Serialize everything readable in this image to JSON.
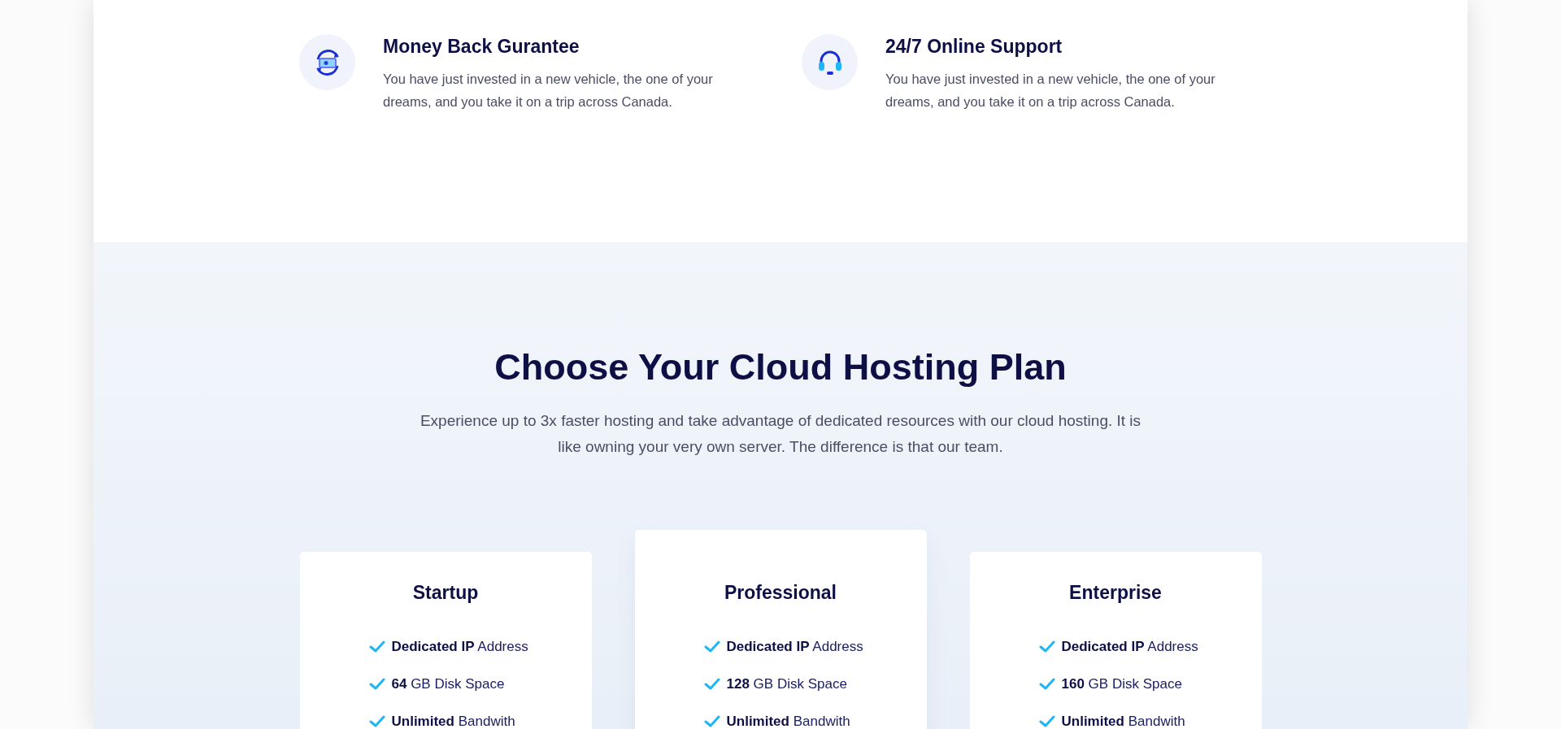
{
  "features": [
    {
      "kind": "money",
      "title": "Money Back Gurantee",
      "text": "You have just invested in a new vehicle, the one of your dreams, and you take it on a trip across Canada."
    },
    {
      "kind": "headset",
      "title": "24/7 Online Support",
      "text": "You have just invested in a new vehicle, the one of your dreams, and you take it on a trip across Canada."
    }
  ],
  "pricing": {
    "title": "Choose Your Cloud Hosting Plan",
    "subtitle": "Experience up to 3x faster hosting and take advantage of dedicated resources with our cloud hosting. It is like owning your very own server. The difference is that our team.",
    "plans": [
      {
        "name": "Startup",
        "selected": false,
        "features": [
          "**Dedicated IP** Address",
          "**64** GB Disk Space",
          "**Unlimited** Bandwith"
        ]
      },
      {
        "name": "Professional",
        "selected": true,
        "features": [
          "**Dedicated IP** Address",
          "**128** GB Disk Space",
          "**Unlimited** Bandwith"
        ]
      },
      {
        "name": "Enterprise",
        "selected": false,
        "features": [
          "**Dedicated IP** Address",
          "**160** GB Disk Space",
          "**Unlimited** Bandwith"
        ]
      }
    ]
  }
}
